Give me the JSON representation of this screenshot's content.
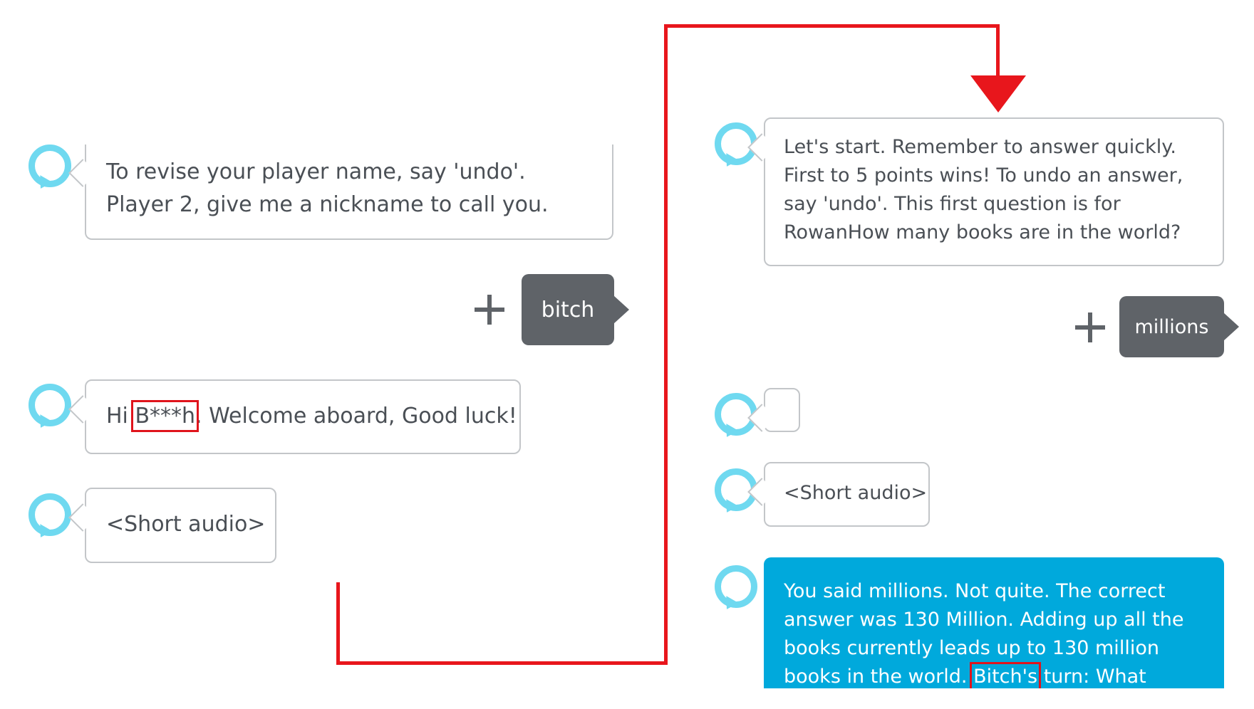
{
  "left": {
    "alexa_msg_1": "To revise your player name, say 'undo'. Player 2, give me a nickname to call you.",
    "user_utterance_1": "bitch",
    "alexa_msg_2": {
      "prefix": "Hi ",
      "masked_name": "B***h",
      "suffix": ". Welcome aboard, Good luck!"
    },
    "alexa_msg_3": "<Short audio>"
  },
  "right": {
    "alexa_msg_1": "Let's start. Remember to answer quickly. First to 5 points wins! To undo an answer, say 'undo'. This first question is for RowanHow many books are in the world?",
    "user_utterance_1": "millions",
    "alexa_msg_3": "<Short audio>",
    "alexa_msg_4": {
      "prefix": "You said millions. Not quite. The correct answer was 130 Million. Adding up all the books currently leads up to 130 million books in the world. ",
      "name": "Bitch's",
      "suffix": " turn: What comes on the"
    }
  },
  "colors": {
    "alexa_ring": "#6fd9f0",
    "user_bubble": "#5f6368",
    "alexa_highlight_bubble": "#00a9dc",
    "annotation_red": "#e8161c"
  },
  "icons": [
    "alexa-avatar-icon",
    "plus-icon",
    "flow-arrow-icon"
  ]
}
